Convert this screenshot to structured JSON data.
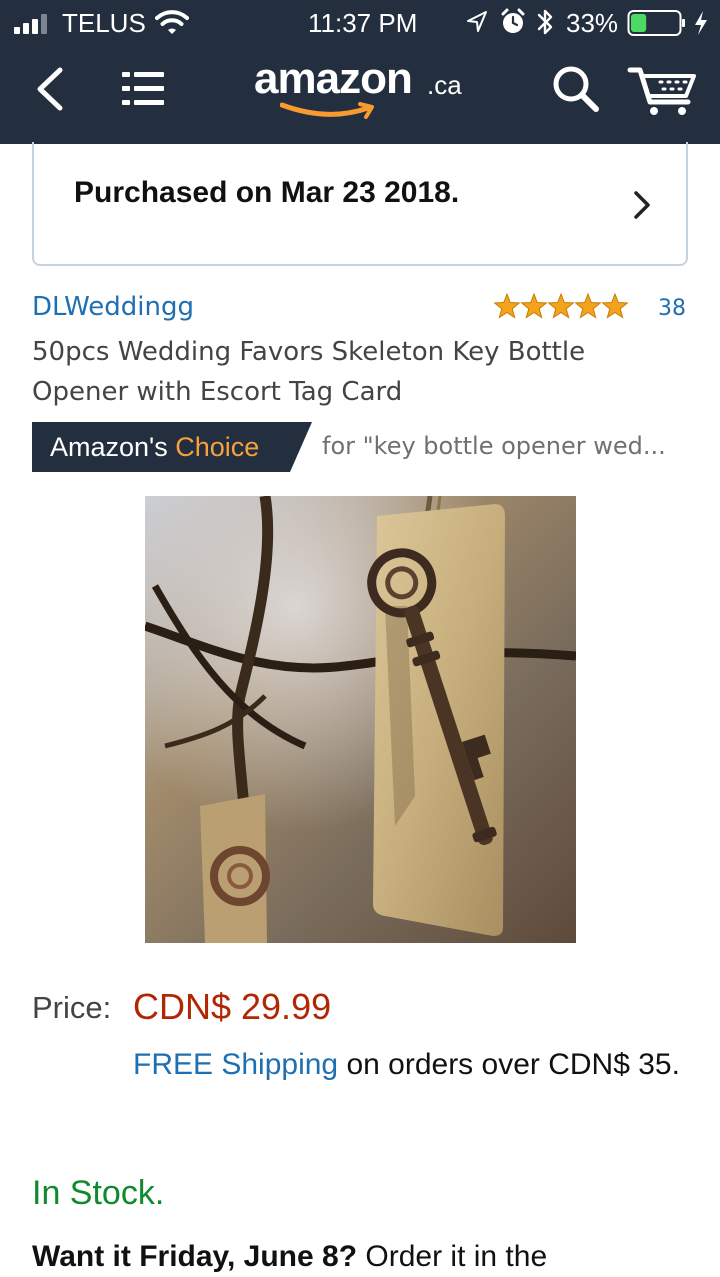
{
  "status_bar": {
    "carrier": "TELUS",
    "time": "11:37 PM",
    "battery_percent": "33%",
    "battery_level": 0.33,
    "signal_bars": 3,
    "signal_bars_total": 4,
    "icons": [
      "signal-icon",
      "wifi-icon",
      "location-icon",
      "alarm-icon",
      "bluetooth-icon",
      "battery-icon",
      "charging-icon"
    ]
  },
  "nav": {
    "logo_word": "amazon",
    "logo_tld": ".ca",
    "icons": [
      "back-icon",
      "menu-icon",
      "search-icon",
      "cart-icon"
    ],
    "bar_color": "#232f3e",
    "logo_smile_color": "#f79a2f"
  },
  "order": {
    "purchased_text": "Purchased on Mar 23 2018."
  },
  "product": {
    "brand": "DLWeddingg",
    "rating_stars": 5,
    "rating_count": "38",
    "title": "50pcs Wedding Favors Skeleton Key Bottle Opener with Escort Tag Card",
    "badge_prefix": "Amazon's ",
    "badge_highlight": "Choice",
    "badge_query": "for \"key bottle opener wed...",
    "image_alt": "Vintage skeleton key bottle opener tied with twine to a kraft escort tag card"
  },
  "pricing": {
    "price_label": "Price:",
    "price_value": "CDN$ 29.99",
    "shipping_link": "FREE Shipping",
    "shipping_rest": " on orders over CDN$ 35."
  },
  "availability": {
    "stock": "In Stock.",
    "delivery_bold": "Want it Friday, June 8?",
    "delivery_rest": " Order it in the"
  },
  "colors": {
    "link": "#1f6fb2",
    "price": "#b12704",
    "in_stock": "#118a2f",
    "star": "#f4a41c",
    "badge_bg": "#232f3e",
    "badge_highlight": "#f8a03c"
  }
}
